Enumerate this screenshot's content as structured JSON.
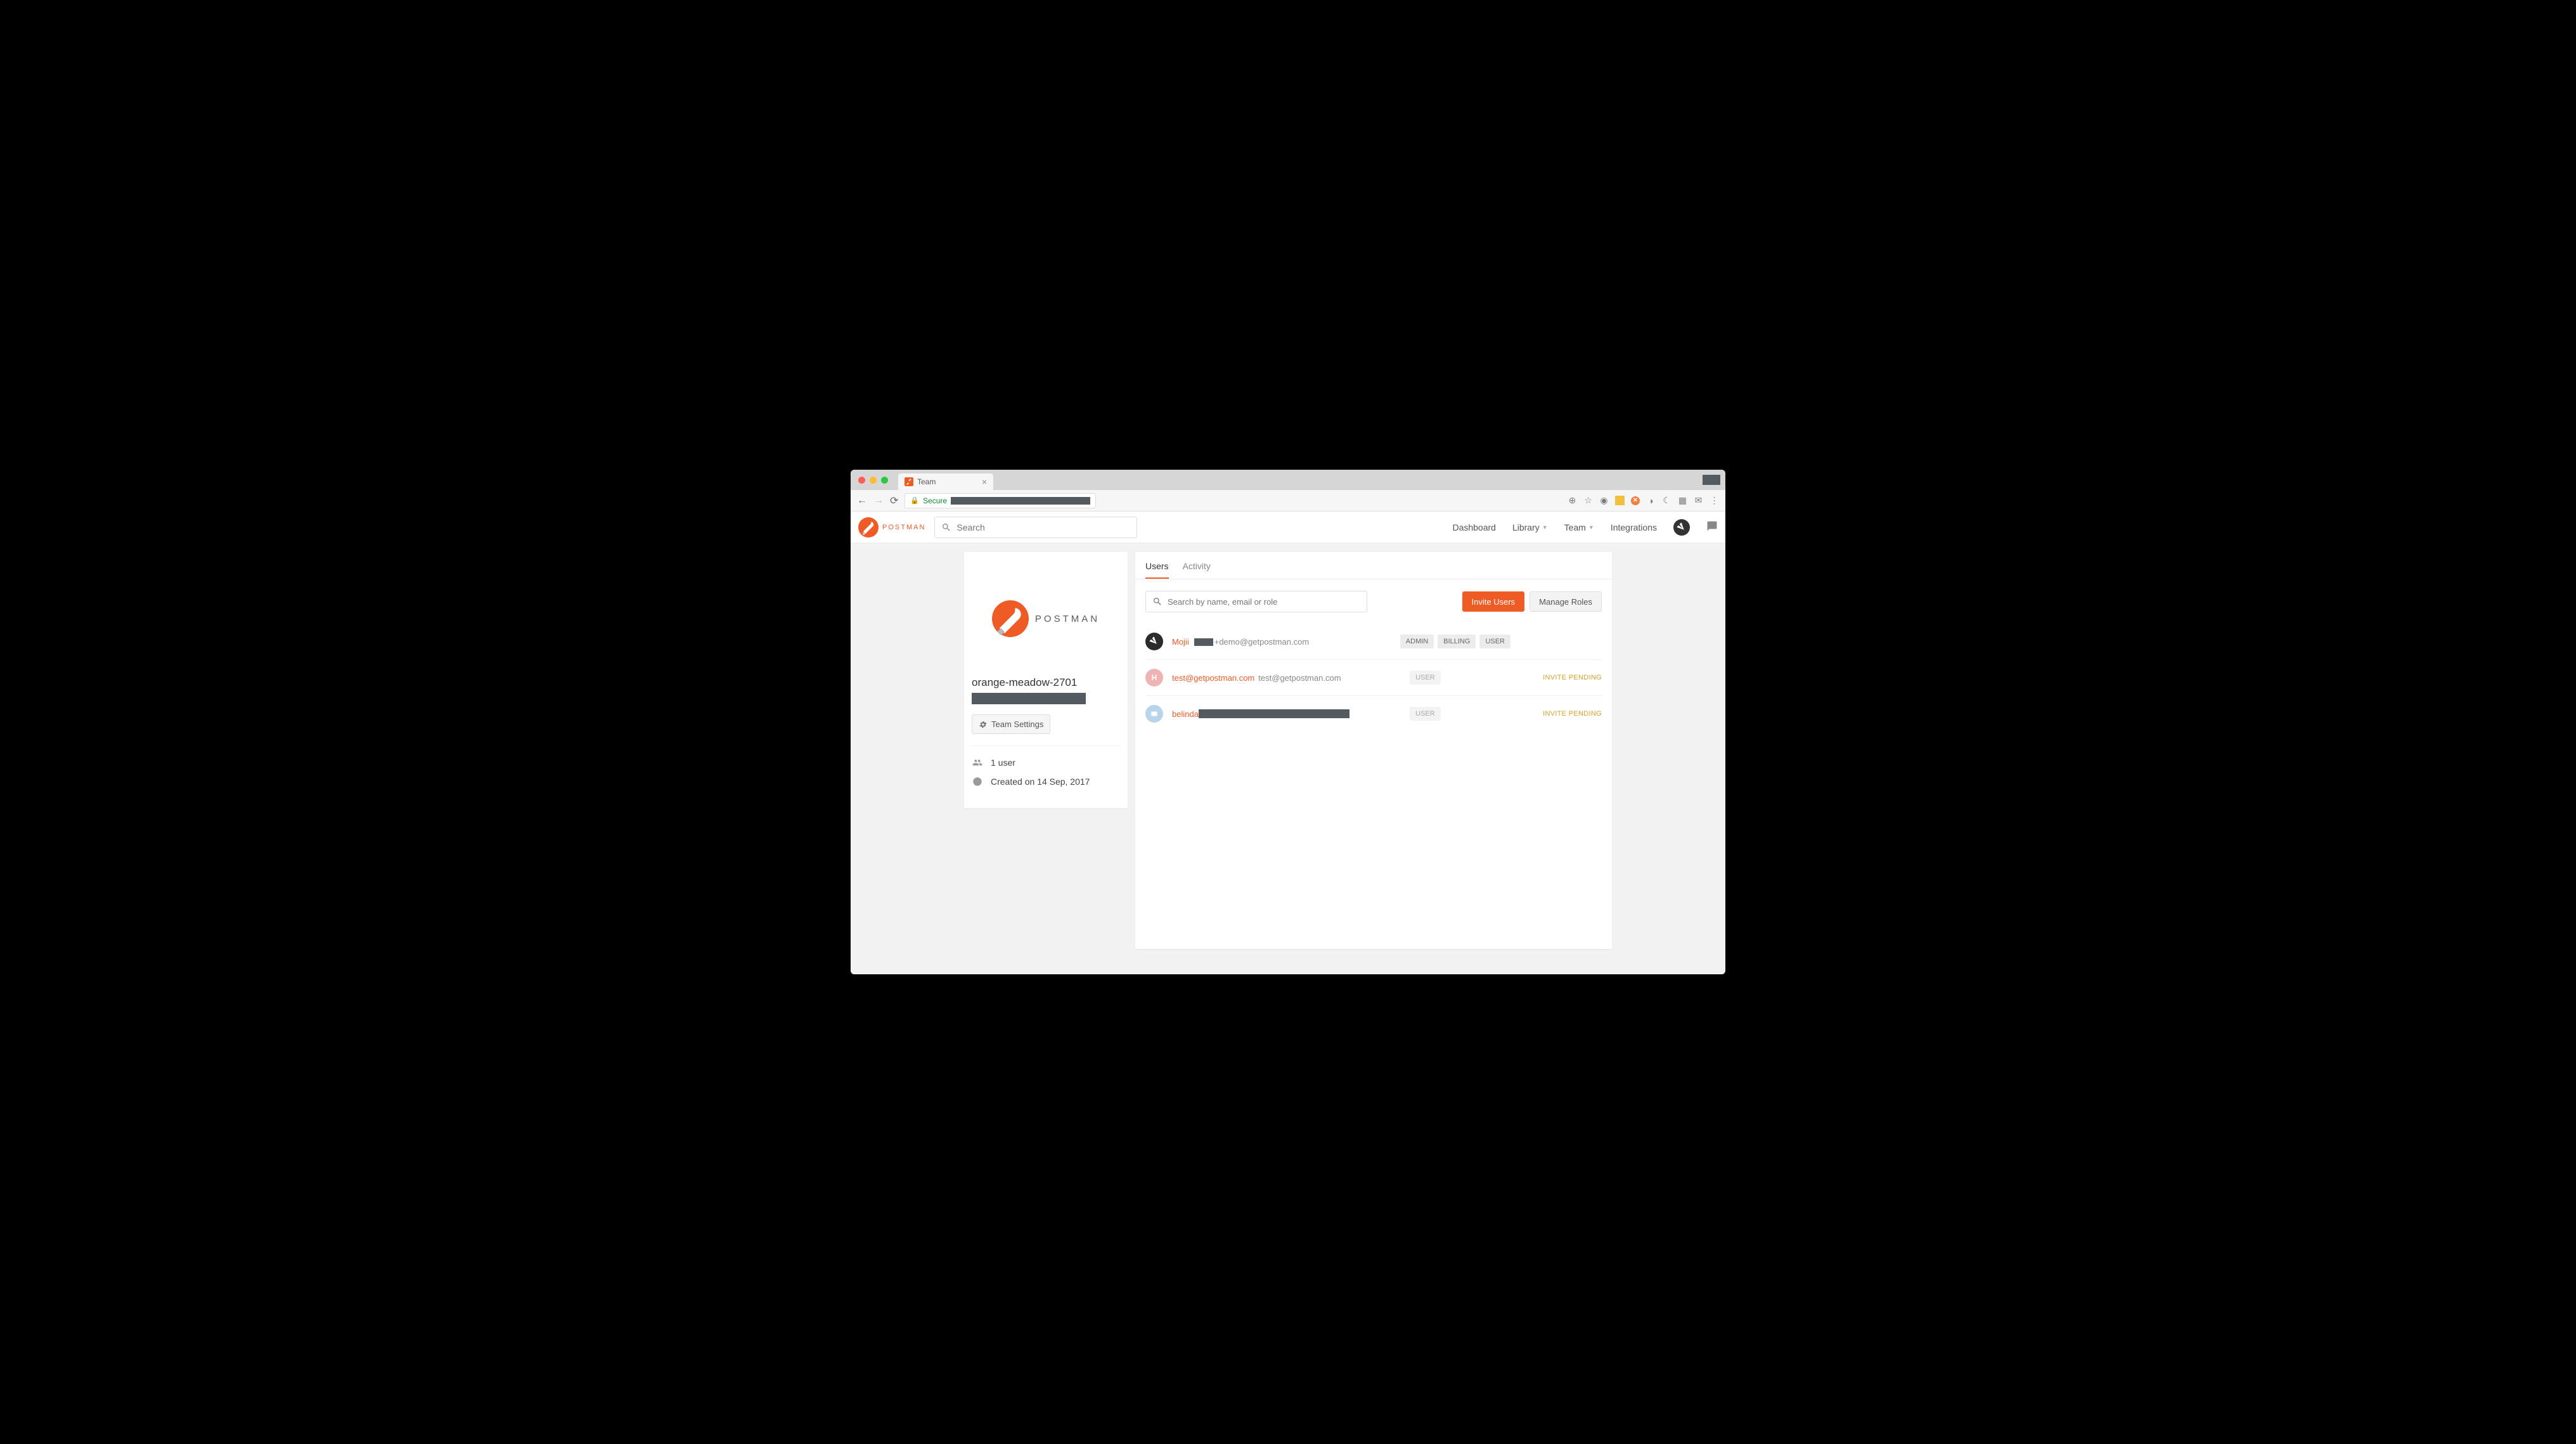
{
  "browser": {
    "tab_title": "Team",
    "secure_label": "Secure"
  },
  "header": {
    "brand": "POSTMAN",
    "search_placeholder": "Search",
    "nav": {
      "dashboard": "Dashboard",
      "library": "Library",
      "team": "Team",
      "integrations": "Integrations"
    }
  },
  "sidebar": {
    "brand": "POSTMAN",
    "team_name": "orange-meadow-2701",
    "settings_label": "Team Settings",
    "user_count": "1 user",
    "created_label": "Created on 14 Sep, 2017"
  },
  "tabs": {
    "users": "Users",
    "activity": "Activity"
  },
  "users_toolbar": {
    "search_placeholder": "Search by name, email or role",
    "invite_label": "Invite Users",
    "manage_label": "Manage Roles"
  },
  "users": [
    {
      "name": "Mojii",
      "email_suffix": "+demo@getpostman.com",
      "roles": [
        "ADMIN",
        "BILLING",
        "USER"
      ],
      "pending": false
    },
    {
      "name": "test@getpostman.com",
      "email": "test@getpostman.com",
      "roles": [
        "USER"
      ],
      "pending": true
    },
    {
      "name": "belinda",
      "roles": [
        "USER"
      ],
      "pending": true
    }
  ],
  "labels": {
    "invite_pending": "INVITE PENDING"
  }
}
